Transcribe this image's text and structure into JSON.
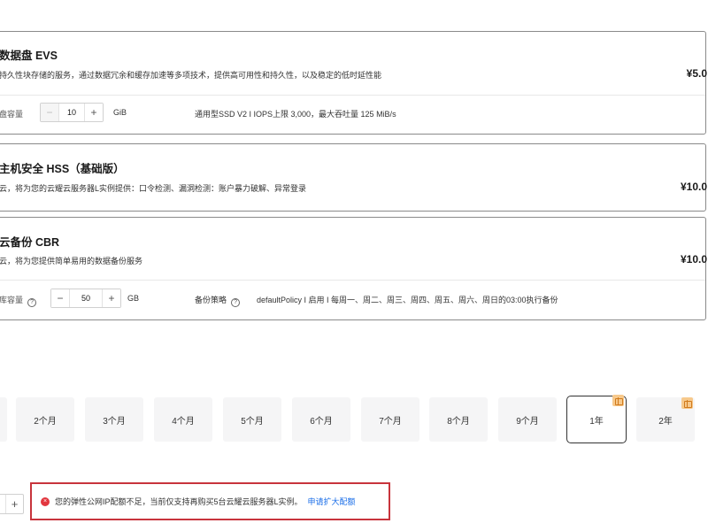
{
  "evs": {
    "title": "数据盘 EVS",
    "desc": "持久性块存储的服务，通过数据冗余和缓存加速等多项技术，提供高可用性和持久性，以及稳定的低时延性能",
    "price": "¥5.0",
    "label": "盘容量",
    "minus": "−",
    "value": "10",
    "plus": "+",
    "unit": "GiB",
    "spec": "通用型SSD V2 I IOPS上限 3,000，最大吞吐量 125 MiB/s"
  },
  "hss": {
    "title": "主机安全 HSS（基础版）",
    "desc": "云，将为您的云耀云服务器L实例提供：口令检测、漏洞检测：账户暴力破解、异常登录",
    "price": "¥10.0"
  },
  "cbr": {
    "title": "云备份 CBR",
    "desc": "云，将为您提供简单易用的数据备份服务",
    "price": "¥10.0",
    "label": "库容量",
    "help": "?",
    "minus": "−",
    "value": "50",
    "plus": "+",
    "unit": "GB",
    "policy_label": "备份策略",
    "policy_help": "?",
    "policy_value": "defaultPolicy I 启用 I 每周一、周二、周三、周四、周五、周六、周日的03:00执行备份"
  },
  "durations": [
    "2个月",
    "3个月",
    "4个月",
    "5个月",
    "6个月",
    "7个月",
    "8个月",
    "9个月",
    "1年",
    "2年"
  ],
  "selected_duration": "1年",
  "quantity": {
    "plus": "+"
  },
  "alert": {
    "icon": "×",
    "message": "您的弹性公网IP配额不足，当前仅支持再购买5台云耀云服务器L实例。",
    "link": "申请扩大配额"
  },
  "colors": {
    "error": "#e2373f",
    "link": "#1a6ee8",
    "gift": "#f7c98c"
  }
}
